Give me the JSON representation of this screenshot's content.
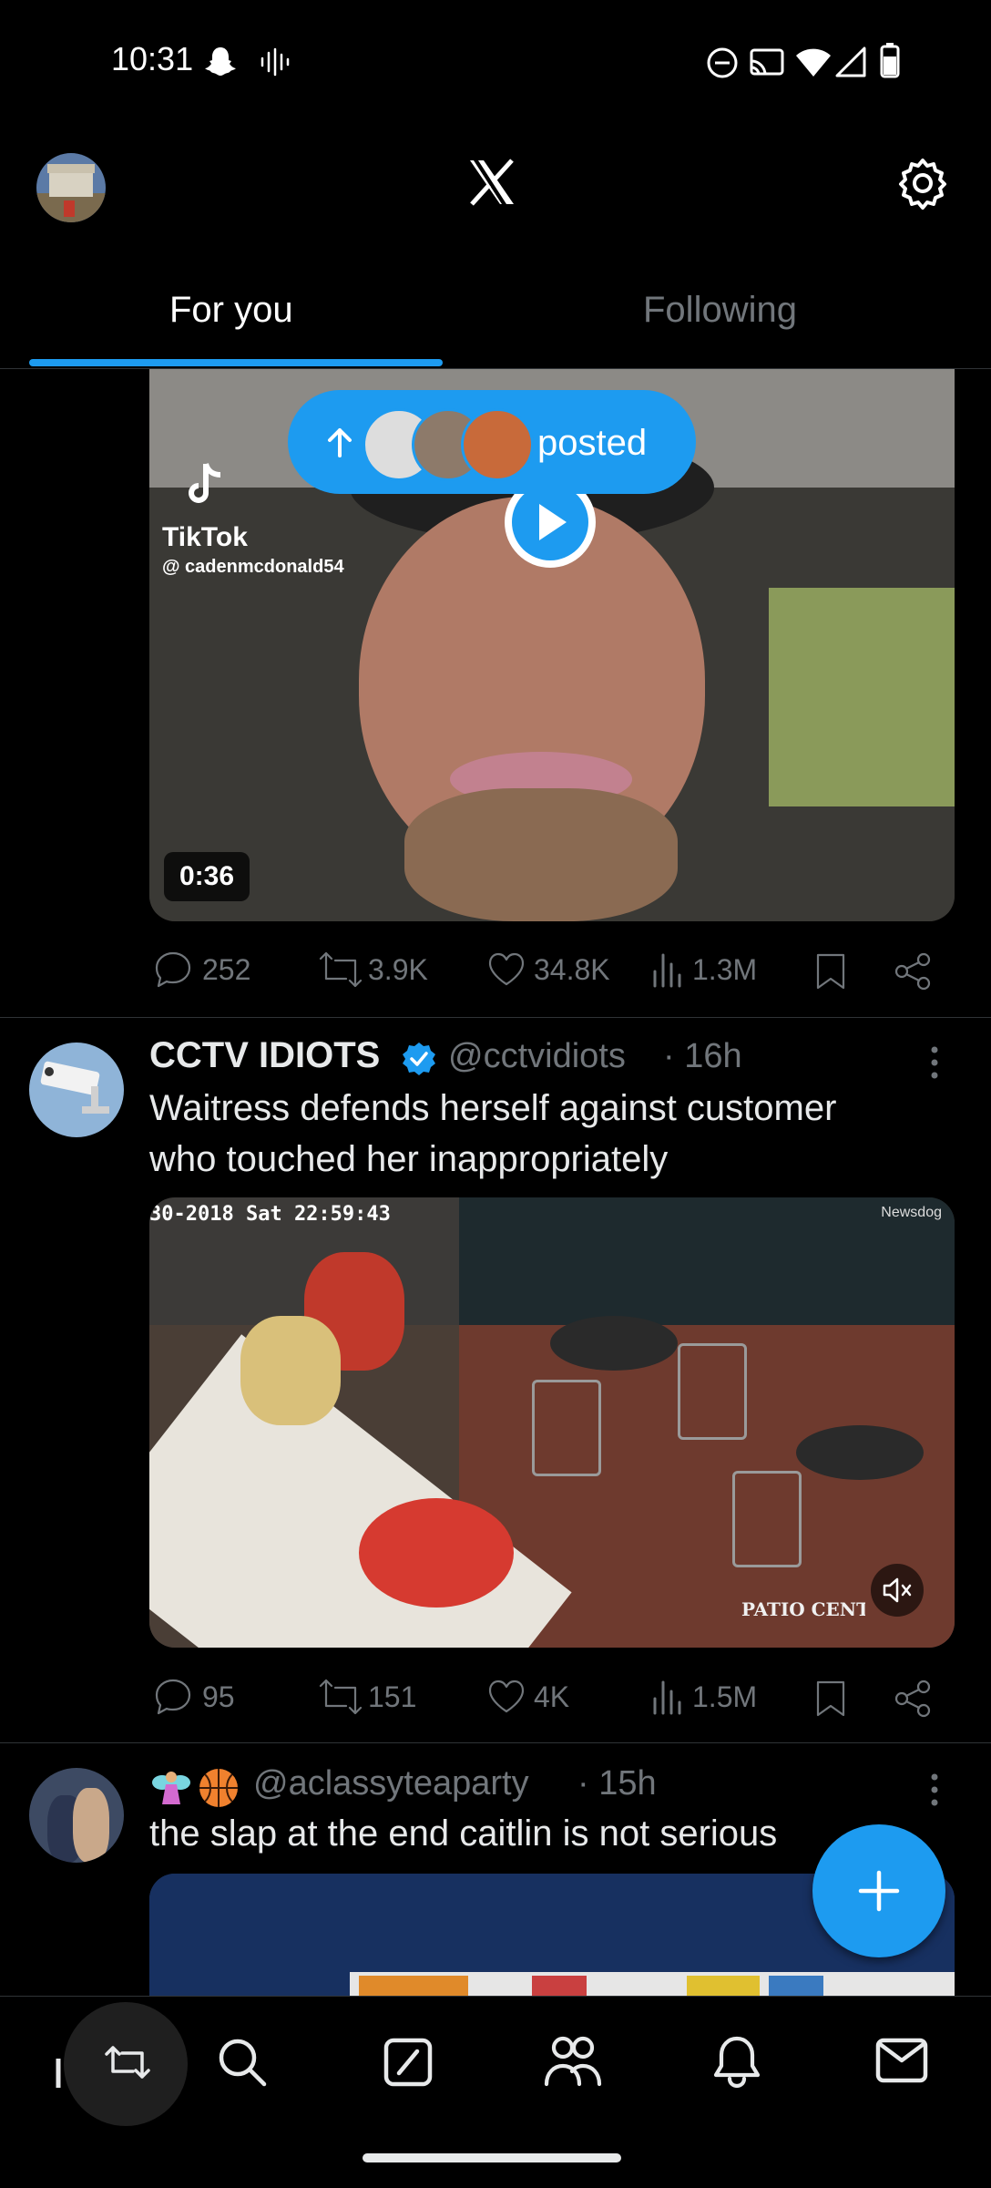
{
  "status_bar": {
    "time": "10:31"
  },
  "header": {
    "logo_icon": "x-logo-icon",
    "settings_icon": "gear-icon"
  },
  "tabs": [
    {
      "label": "For you"
    },
    {
      "label": "Following"
    }
  ],
  "new_posts_pill": {
    "label": "posted"
  },
  "tweet1": {
    "tiktok_label": "TikTok",
    "tiktok_user": "@ cadenmcdonald54",
    "duration": "0:36",
    "replies": "252",
    "reposts": "3.9K",
    "likes": "34.8K",
    "views": "1.3M"
  },
  "tweet2": {
    "name": "CCTV IDIOTS",
    "handle": "@cctvidiots",
    "time": "· 16h",
    "text_line1": "Waitress defends herself against customer",
    "text_line2": "who touched her inappropriately",
    "video_timestamp": "30-2018 Sat 22:59:43",
    "video_watermark": "Newsdog",
    "video_sign": "PATIO CENTER",
    "replies": "95",
    "reposts": "151",
    "likes": "4K",
    "views": "1.5M"
  },
  "tweet3": {
    "handle": "@aclassyteaparty",
    "time": "· 15h",
    "text": "the slap at the end caitlin is not serious"
  },
  "colors": {
    "accent": "#1d9bf0",
    "text": "#e7e9ea",
    "muted": "#71767b",
    "divider": "#2f3336",
    "background": "#000000"
  }
}
